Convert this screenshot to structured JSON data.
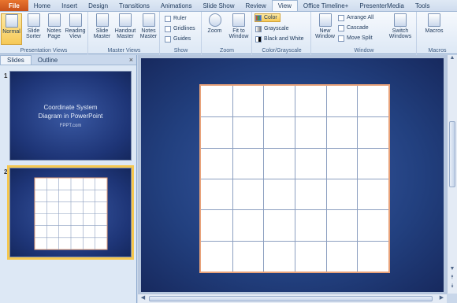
{
  "tabs": [
    "File",
    "Home",
    "Insert",
    "Design",
    "Transitions",
    "Animations",
    "Slide Show",
    "Review",
    "View",
    "Office Timeline+",
    "PresenterMedia",
    "Tools"
  ],
  "active_tab": "View",
  "ribbon": {
    "presentation_views": {
      "label": "Presentation Views",
      "normal": "Normal",
      "slide_sorter": [
        "Slide",
        "Sorter"
      ],
      "notes_page": [
        "Notes",
        "Page"
      ],
      "reading_view": [
        "Reading",
        "View"
      ]
    },
    "master_views": {
      "label": "Master Views",
      "slide_master": [
        "Slide",
        "Master"
      ],
      "handout_master": [
        "Handout",
        "Master"
      ],
      "notes_master": [
        "Notes",
        "Master"
      ]
    },
    "show": {
      "label": "Show",
      "ruler": "Ruler",
      "gridlines": "Gridlines",
      "guides": "Guides"
    },
    "zoom": {
      "label": "Zoom",
      "zoom": "Zoom",
      "fit_to_window": [
        "Fit to",
        "Window"
      ]
    },
    "color_grayscale": {
      "label": "Color/Grayscale",
      "color": "Color",
      "grayscale": "Grayscale",
      "black_and_white": "Black and White"
    },
    "window": {
      "label": "Window",
      "new_window": [
        "New",
        "Window"
      ],
      "arrange_all": "Arrange All",
      "cascade": "Cascade",
      "move_split": "Move Split",
      "switch_windows": [
        "Switch",
        "Windows"
      ]
    },
    "macros": {
      "label": "Macros",
      "macros": "Macros"
    }
  },
  "pane": {
    "tabs": [
      "Slides",
      "Outline"
    ],
    "close": "×",
    "slides": [
      {
        "number": "1",
        "title": "Coordinate System Diagram in PowerPoint",
        "title_line1": "Coordinate System",
        "title_line2": "Diagram in PowerPoint",
        "subtitle": "FPPT.com"
      },
      {
        "number": "2"
      }
    ]
  },
  "scroll": {
    "up": "▲",
    "down": "▼",
    "left": "◀",
    "right": "▶",
    "prev": "⯭",
    "next": "⯯"
  }
}
